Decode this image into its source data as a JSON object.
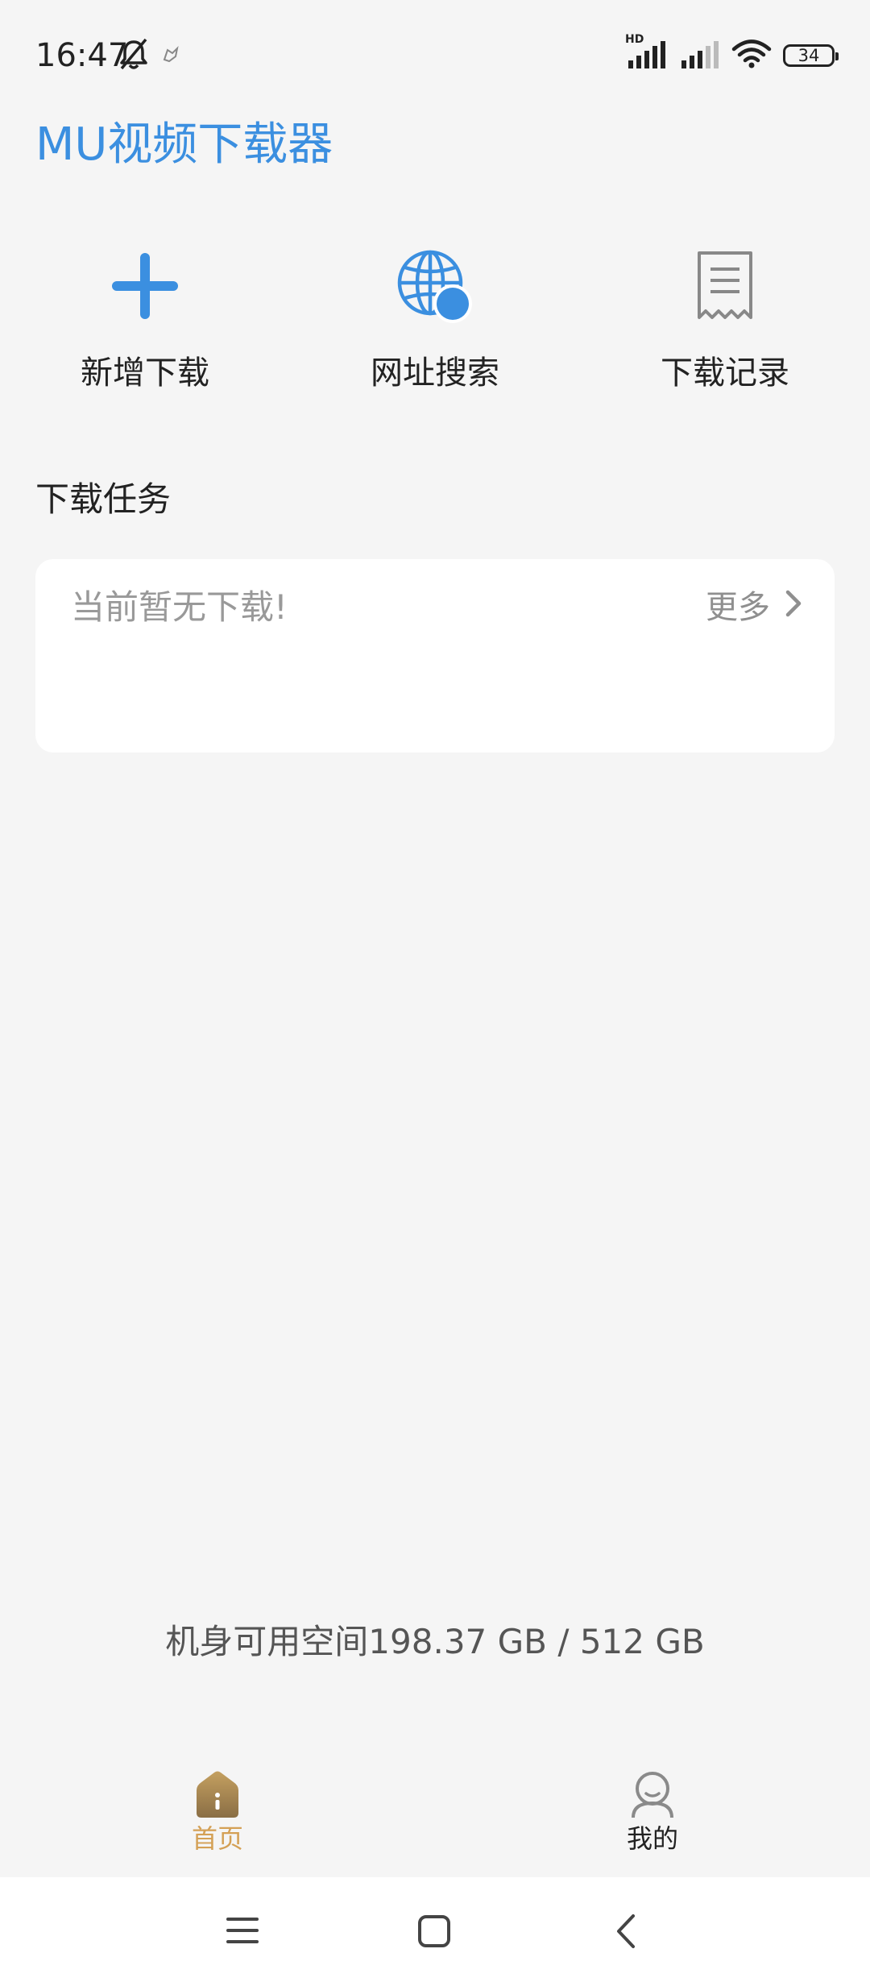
{
  "status_bar": {
    "time": "16:47",
    "battery": "34",
    "network_label": "HD"
  },
  "app": {
    "title": "MU视频下载器",
    "accent_color": "#3b8fe0"
  },
  "actions": [
    {
      "label": "新增下载",
      "icon": "plus-icon"
    },
    {
      "label": "网址搜索",
      "icon": "globe-icon"
    },
    {
      "label": "下载记录",
      "icon": "receipt-icon"
    }
  ],
  "tasks": {
    "section_title": "下载任务",
    "empty_text": "当前暂无下载!",
    "more_label": "更多"
  },
  "storage": {
    "text": "机身可用空间198.37 GB / 512 GB"
  },
  "bottom_tabs": [
    {
      "label": "首页",
      "icon": "home-icon",
      "active": true,
      "color": "#d4a055"
    },
    {
      "label": "我的",
      "icon": "user-icon",
      "active": false,
      "color": "#222222"
    }
  ]
}
